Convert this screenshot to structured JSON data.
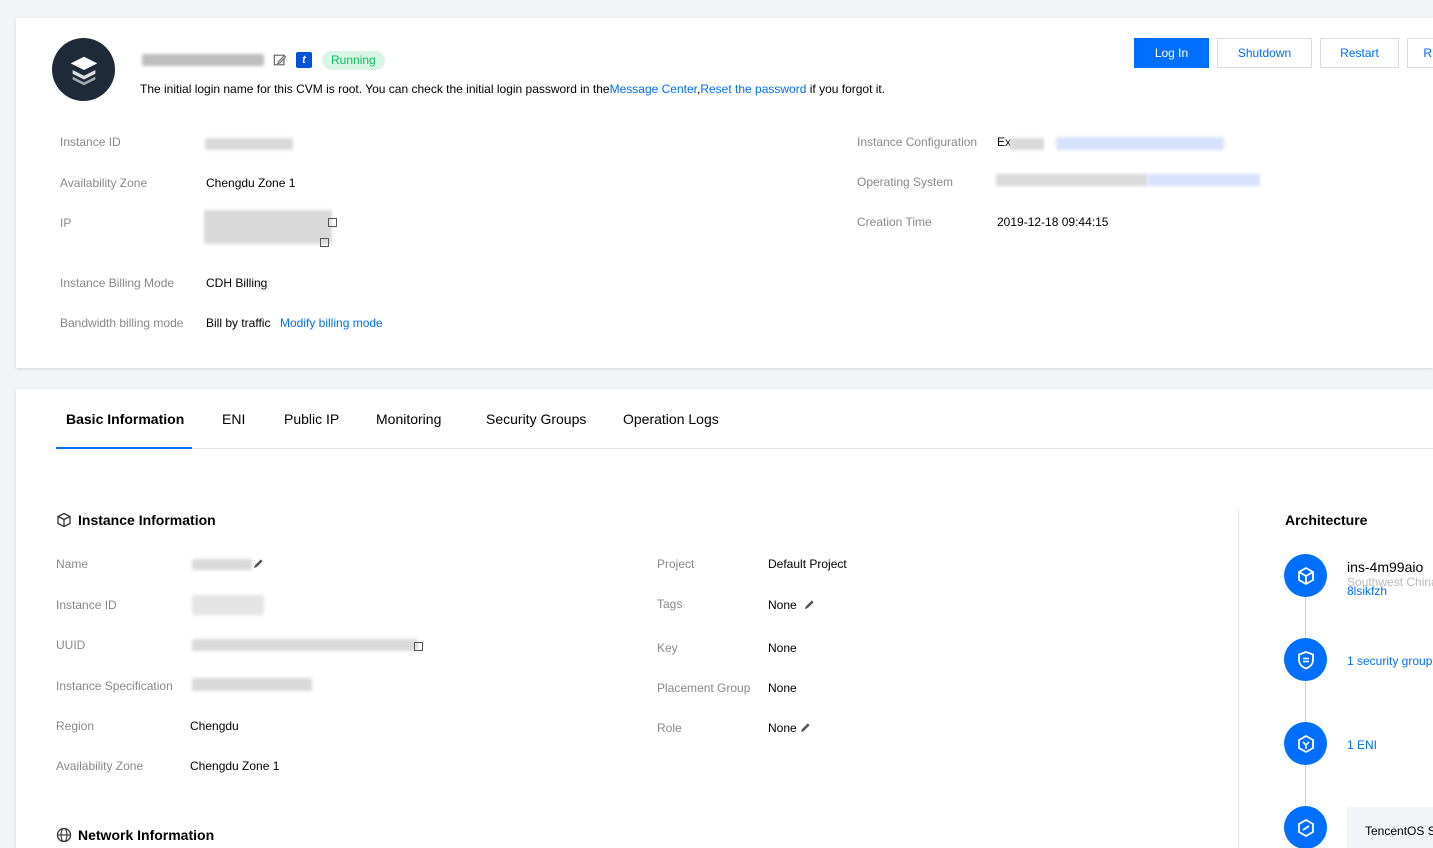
{
  "header": {
    "status": "Running",
    "login_tip_prefix": "The initial login name for this CVM is root. You can check the initial login password in the",
    "message_center_link": "Message Center",
    "reset_password_link": "Reset the password",
    "login_tip_suffix": "if you forgot it.",
    "buttons": {
      "login": "Log In",
      "shutdown": "Shutdown",
      "restart": "Restart",
      "more": "R"
    }
  },
  "summary": {
    "instance_id_label": "Instance ID",
    "availability_zone_label": "Availability Zone",
    "availability_zone_value": "Chengdu Zone 1",
    "ip_label": "IP",
    "billing_mode_label": "Instance Billing Mode",
    "billing_mode_value": "CDH Billing",
    "bandwidth_label": "Bandwidth billing mode",
    "bandwidth_value": "Bill by traffic",
    "modify_billing_link": "Modify billing mode",
    "instance_config_label": "Instance Configuration",
    "instance_config_value_prefix": "Ex",
    "os_label": "Operating System",
    "creation_time_label": "Creation Time",
    "creation_time_value": "2019-12-18 09:44:15"
  },
  "tabs": [
    "Basic Information",
    "ENI",
    "Public IP",
    "Monitoring",
    "Security Groups",
    "Operation Logs"
  ],
  "instance_info": {
    "title": "Instance Information",
    "name_label": "Name",
    "instance_id_label": "Instance ID",
    "uuid_label": "UUID",
    "spec_label": "Instance Specification",
    "region_label": "Region",
    "region_value": "Chengdu",
    "zone_label": "Availability Zone",
    "zone_value": "Chengdu Zone 1",
    "project_label": "Project",
    "project_value": "Default Project",
    "tags_label": "Tags",
    "tags_value": "None",
    "key_label": "Key",
    "key_value": "None",
    "placement_label": "Placement Group",
    "placement_value": "None",
    "role_label": "Role",
    "role_value": "None"
  },
  "network_info": {
    "title": "Network Information"
  },
  "architecture": {
    "title": "Architecture",
    "instance_name": "ins-4m99aio",
    "instance_region": "Southwest China",
    "instance_suffix": "8lsikfzh",
    "security_group": "1 security group",
    "eni": "1 ENI",
    "os_name": "TencentOS Se"
  },
  "colors": {
    "accent": "#006eff",
    "status_bg": "#d9f5e6",
    "status_text": "#0abf5b",
    "avatar_bg": "#1e2a37"
  }
}
